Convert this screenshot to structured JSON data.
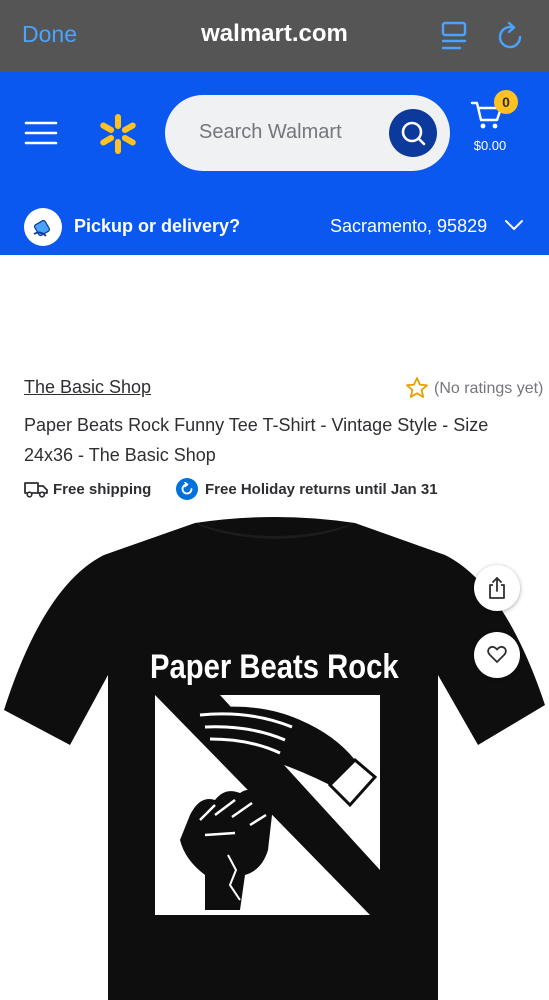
{
  "browser": {
    "done_label": "Done",
    "url": "walmart.com",
    "icons": [
      "reader-icon",
      "reload-icon"
    ]
  },
  "header": {
    "search_placeholder": "Search Walmart",
    "cart_count": "0",
    "cart_total": "$0.00",
    "brand_color": "#0a58f0",
    "accent_color": "#ffc220",
    "icons": [
      "menu-icon",
      "spark-logo-icon",
      "search-icon",
      "cart-icon"
    ]
  },
  "pickup": {
    "label": "Pickup or delivery?",
    "location": "Sacramento, 95829"
  },
  "product": {
    "shop_name": "The Basic Shop",
    "rating_text": "(No ratings yet)",
    "title": "Paper Beats Rock Funny Tee T-Shirt - Vintage Style - Size 24x36 - The Basic Shop",
    "shipping_label": "Free shipping",
    "returns_label": "Free Holiday returns until Jan 31",
    "image_text": "Paper Beats Rock"
  }
}
